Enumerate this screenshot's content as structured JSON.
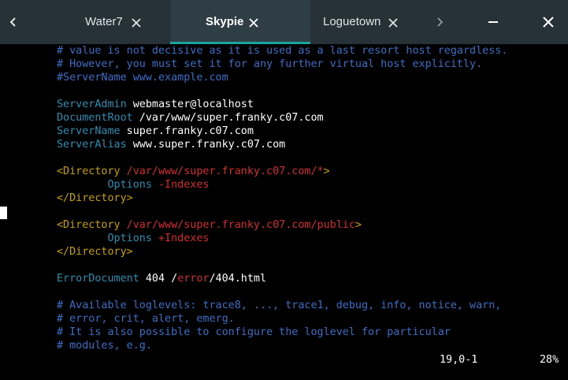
{
  "tabs": [
    {
      "label": "Water7",
      "active": false
    },
    {
      "label": "Skypie",
      "active": true
    },
    {
      "label": "Loguetown",
      "active": false
    }
  ],
  "icons": {
    "back": "chevron-left-icon",
    "forward": "chevron-right-icon",
    "close": "close-icon",
    "minimize": "minimize-icon"
  },
  "colors": {
    "titlebar": "#263238",
    "active_tab": "#2f3d44",
    "active_indicator": "#1ba5a0",
    "comment": "#3a6fc8",
    "keyword": "#2b8eb3",
    "tag": "#c7a000",
    "path": "#d42c2c"
  },
  "editor": {
    "lines": [
      {
        "segments": [
          {
            "t": "# value is not decisive as it is used as a last resort host regardless.",
            "c": "comment"
          }
        ]
      },
      {
        "segments": [
          {
            "t": "# However, you must set it for any further virtual host explicitly.",
            "c": "comment"
          }
        ]
      },
      {
        "segments": [
          {
            "t": "#ServerName www.example.com",
            "c": "comment"
          }
        ]
      },
      {
        "segments": []
      },
      {
        "segments": [
          {
            "t": "ServerAdmin",
            "c": "key"
          },
          {
            "t": " webmaster@localhost",
            "c": "val"
          }
        ]
      },
      {
        "segments": [
          {
            "t": "DocumentRoot",
            "c": "key"
          },
          {
            "t": " /var/www/super.franky.c07.com",
            "c": "val"
          }
        ]
      },
      {
        "segments": [
          {
            "t": "ServerName",
            "c": "key"
          },
          {
            "t": " super.franky.c07.com",
            "c": "val"
          }
        ]
      },
      {
        "segments": [
          {
            "t": "ServerAlias",
            "c": "key"
          },
          {
            "t": " www.super.franky.c07.com",
            "c": "val"
          }
        ]
      },
      {
        "segments": []
      },
      {
        "segments": [
          {
            "t": "<Directory",
            "c": "tag"
          },
          {
            "t": " /var/www/super.franky.c07.com/*",
            "c": "path"
          },
          {
            "t": ">",
            "c": "tag"
          }
        ]
      },
      {
        "segments": [
          {
            "t": "        Options",
            "c": "key"
          },
          {
            "t": " -Indexes",
            "c": "red"
          }
        ]
      },
      {
        "segments": [
          {
            "t": "</Directory>",
            "c": "tag"
          }
        ]
      },
      {
        "segments": []
      },
      {
        "segments": [
          {
            "t": "<Directory",
            "c": "tag"
          },
          {
            "t": " /var/www/super.franky.c07.com/public",
            "c": "path"
          },
          {
            "t": ">",
            "c": "tag"
          }
        ]
      },
      {
        "segments": [
          {
            "t": "        Options",
            "c": "key"
          },
          {
            "t": " +Indexes",
            "c": "red"
          }
        ]
      },
      {
        "segments": [
          {
            "t": "</Directory>",
            "c": "tag"
          }
        ]
      },
      {
        "segments": []
      },
      {
        "segments": [
          {
            "t": "ErrorDocument",
            "c": "key"
          },
          {
            "t": " 404 /",
            "c": "val"
          },
          {
            "t": "error",
            "c": "red"
          },
          {
            "t": "/404.html",
            "c": "val"
          }
        ]
      },
      {
        "segments": []
      },
      {
        "segments": [
          {
            "t": "# Available loglevels: trace8, ..., trace1, debug, info, notice, warn,",
            "c": "comment"
          }
        ]
      },
      {
        "segments": [
          {
            "t": "# error, crit, alert, emerg.",
            "c": "comment"
          }
        ]
      },
      {
        "segments": [
          {
            "t": "# It is also possible to configure the loglevel for particular",
            "c": "comment"
          }
        ]
      },
      {
        "segments": [
          {
            "t": "# modules, e.g.",
            "c": "comment"
          }
        ]
      }
    ]
  },
  "status": {
    "position": "19,0-1",
    "percent": "28%"
  }
}
